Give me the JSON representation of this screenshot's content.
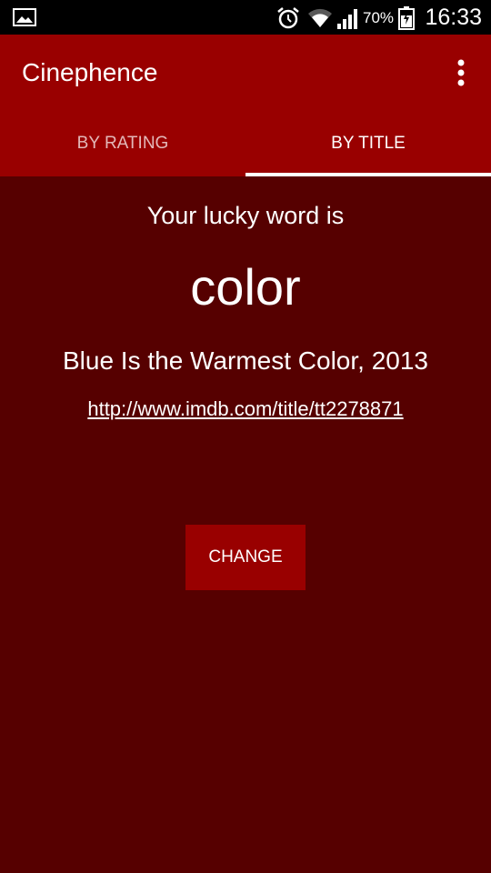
{
  "status_bar": {
    "battery_percent": "70%",
    "time": "16:33",
    "icons": [
      "picture-icon",
      "alarm-icon",
      "wifi-icon",
      "signal-icon",
      "battery-icon"
    ]
  },
  "app_bar": {
    "title": "Cinephence",
    "overflow_icon": "more-vertical-icon",
    "tabs": [
      {
        "label": "BY RATING",
        "selected": false
      },
      {
        "label": "BY TITLE",
        "selected": true
      }
    ]
  },
  "main": {
    "lucky_label": "Your lucky word is",
    "lucky_word": "color",
    "movie": "Blue Is the Warmest Color, 2013",
    "link": "http://www.imdb.com/title/tt2278871",
    "change_label": "CHANGE"
  },
  "colors": {
    "status_bar": "#000000",
    "app_bar": "#990000",
    "background": "#560000",
    "button": "#990000",
    "text": "#ffffff"
  }
}
